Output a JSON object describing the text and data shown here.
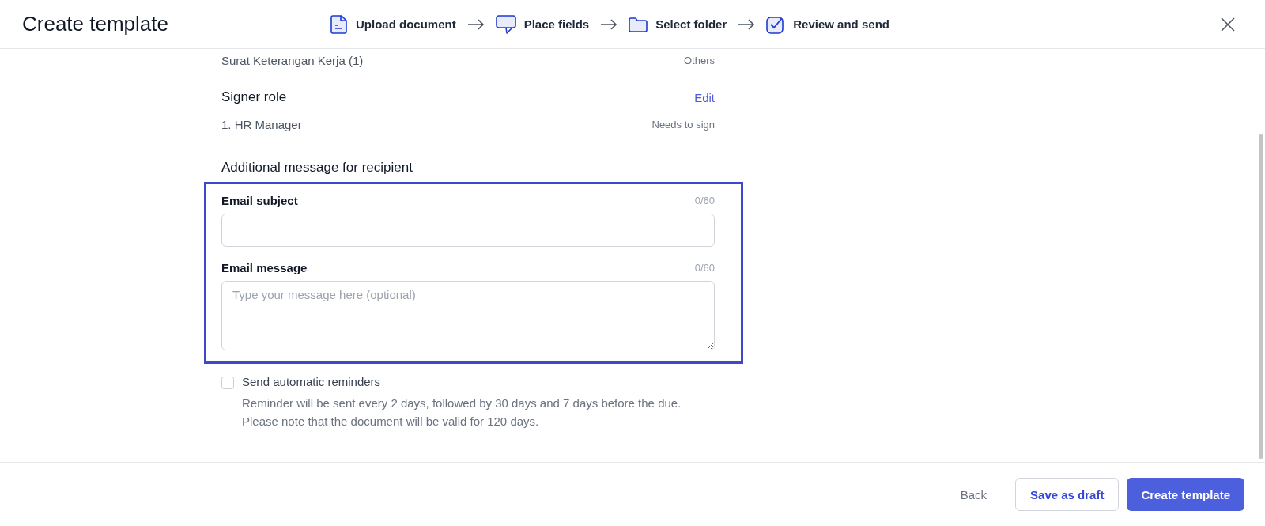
{
  "header": {
    "title": "Create template",
    "steps": [
      {
        "kind": "document",
        "label": "Upload document"
      },
      {
        "kind": "comment",
        "label": "Place fields"
      },
      {
        "kind": "folder",
        "label": "Select folder"
      },
      {
        "kind": "check",
        "label": "Review and send"
      }
    ]
  },
  "document_row": {
    "name": "Surat Keterangan Kerja (1)",
    "category": "Others"
  },
  "signer_section": {
    "title": "Signer role",
    "action": "Edit",
    "signers": [
      {
        "name": "1. HR Manager",
        "role": "Needs to sign"
      }
    ]
  },
  "message_section": {
    "title": "Additional message for recipient",
    "fields": [
      {
        "kind": "input",
        "label": "Email subject",
        "counter": "0/60"
      },
      {
        "kind": "textarea",
        "label": "Email message",
        "counter": "0/60",
        "placeholder": "Type your message here (optional)"
      }
    ]
  },
  "reminders": {
    "label": "Send automatic reminders",
    "checked": false,
    "description": "Reminder will be sent every 2 days, followed by 30 days and 7 days before the due. Please note that the document will be valid for 120 days."
  },
  "footer": {
    "back": "Back",
    "draft": "Save as draft",
    "primary": "Create template"
  }
}
